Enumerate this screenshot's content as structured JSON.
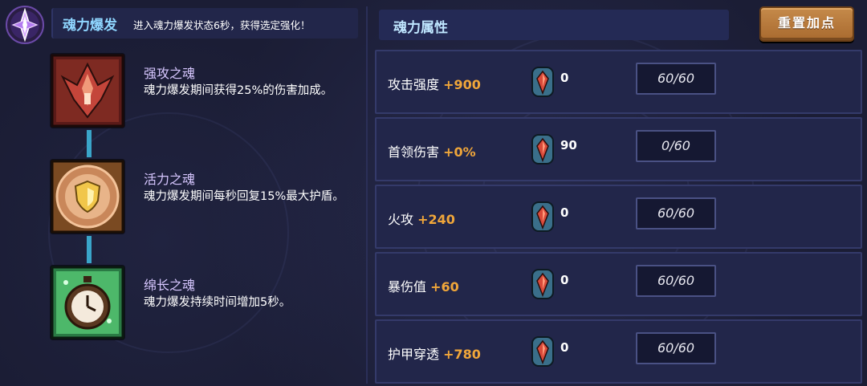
{
  "burst": {
    "title": "魂力爆发",
    "description": "进入魂力爆发状态6秒，获得选定强化！",
    "emblem_icon": "purple-crystal-emblem-icon"
  },
  "souls": [
    {
      "name": "强攻之魂",
      "description": "魂力爆发期间获得25%的伤害加成。",
      "icon": "red-claw-icon"
    },
    {
      "name": "活力之魂",
      "description": "魂力爆发期间每秒回复15%最大护盾。",
      "icon": "golden-shield-icon"
    },
    {
      "name": "绵长之魂",
      "description": "魂力爆发持续时间增加5秒。",
      "icon": "green-stopwatch-icon"
    }
  ],
  "attributes_panel": {
    "title": "魂力属性",
    "reset_label": "重置加点"
  },
  "attributes": [
    {
      "name": "攻击强度",
      "bonus": "+900",
      "invested": "0",
      "level": "60/60"
    },
    {
      "name": "首领伤害",
      "bonus": "+0%",
      "invested": "90",
      "level": "0/60"
    },
    {
      "name": "火攻",
      "bonus": "+240",
      "invested": "0",
      "level": "60/60"
    },
    {
      "name": "暴伤值",
      "bonus": "+60",
      "invested": "0",
      "level": "60/60"
    },
    {
      "name": "护甲穿透",
      "bonus": "+780",
      "invested": "0",
      "level": "60/60"
    }
  ],
  "colors": {
    "background": "#1b1d35",
    "accent_title": "#8fd6ff",
    "bonus": "#f0a63a",
    "button": "#b97a3c",
    "connector": "#3aa5c9"
  }
}
